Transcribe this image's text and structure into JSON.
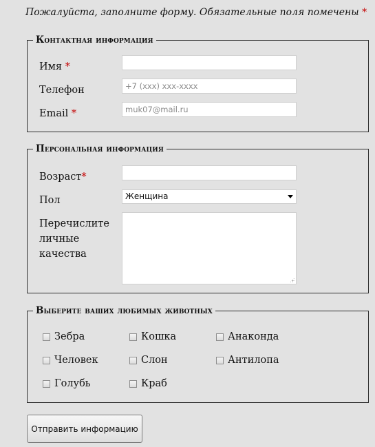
{
  "intro": {
    "text": "Пожалуйста, заполните форму. Обязательные поля помечены",
    "required_mark": "*"
  },
  "contact": {
    "legend": "Контактная информация",
    "name_label": "Имя",
    "name_required": "*",
    "name_value": "",
    "phone_label": "Телефон",
    "phone_placeholder": "+7 (xxx) xxx-xxxx",
    "email_label": "Email",
    "email_required": "*",
    "email_placeholder": "muk07@mail.ru"
  },
  "personal": {
    "legend": "Персональная информация",
    "age_label": "Возраст",
    "age_required": "*",
    "age_value": "",
    "gender_label": "Пол",
    "gender_selected": "Женщина",
    "qualities_label_line1": "Перечислите",
    "qualities_label_line2": "личные",
    "qualities_label_line3": "качества",
    "qualities_value": ""
  },
  "animals": {
    "legend": "Выберите ваших любимых животных",
    "items": [
      {
        "label": "Зебра",
        "checked": false
      },
      {
        "label": "Кошка",
        "checked": false
      },
      {
        "label": "Анаконда",
        "checked": false
      },
      {
        "label": "Человек",
        "checked": false
      },
      {
        "label": "Слон",
        "checked": false
      },
      {
        "label": "Антилопа",
        "checked": false
      },
      {
        "label": "Голубь",
        "checked": false
      },
      {
        "label": "Краб",
        "checked": false
      }
    ]
  },
  "submit": {
    "label": "Отправить информацию"
  },
  "colors": {
    "background": "#e2e2e2",
    "required": "#c40000",
    "border": "#2b2b2b"
  }
}
